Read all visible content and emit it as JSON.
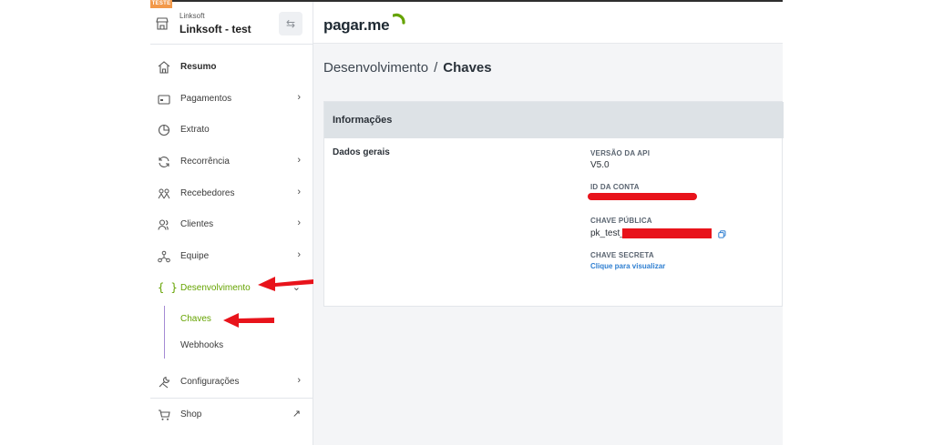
{
  "env_badge": "TESTE",
  "account": {
    "org": "Linksoft",
    "name": "Linksoft - test",
    "switch_glyph": "⇆"
  },
  "nav": [
    {
      "label": "Resumo",
      "icon": "home-icon",
      "chevron": ""
    },
    {
      "label": "Pagamentos",
      "icon": "card-icon",
      "chevron": "›"
    },
    {
      "label": "Extrato",
      "icon": "pie-icon",
      "chevron": ""
    },
    {
      "label": "Recorrência",
      "icon": "refresh-icon",
      "chevron": "›"
    },
    {
      "label": "Recebedores",
      "icon": "people-icon",
      "chevron": "›"
    },
    {
      "label": "Clientes",
      "icon": "users-icon",
      "chevron": "›"
    },
    {
      "label": "Equipe",
      "icon": "team-icon",
      "chevron": "›"
    },
    {
      "label": "Desenvolvimento",
      "icon": "code-icon",
      "chevron": "⌄"
    },
    {
      "label": "Configurações",
      "icon": "tools-icon",
      "chevron": "›"
    },
    {
      "label": "Shop",
      "icon": "cart-icon",
      "chevron": "↗"
    }
  ],
  "subnav": [
    {
      "label": "Chaves"
    },
    {
      "label": "Webhooks"
    }
  ],
  "code_glyph": "{ }",
  "brand": {
    "name": "pagar.me"
  },
  "breadcrumb": {
    "parent": "Desenvolvimento",
    "sep": "/",
    "current": "Chaves"
  },
  "card": {
    "title": "Informações",
    "section": "Dados gerais",
    "api_version_label": "VERSÃO DA API",
    "api_version_value": "V5.0",
    "account_id_label": "ID DA CONTA",
    "public_key_label": "CHAVE PÚBLICA",
    "public_key_prefix": "pk_test_",
    "secret_key_label": "CHAVE SECRETA",
    "secret_key_link": "Clique para visualizar"
  },
  "colors": {
    "accent": "#65a300",
    "link": "#2f7fd1",
    "redaction": "#e8131b",
    "arrow": "#e8131b"
  }
}
